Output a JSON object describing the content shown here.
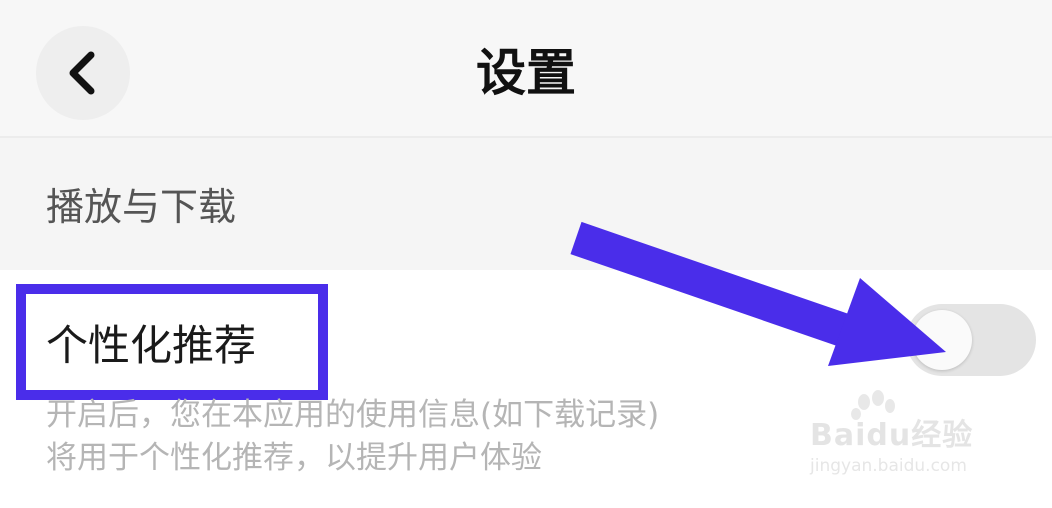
{
  "header": {
    "title": "设置",
    "back_icon": "chevron-left-icon"
  },
  "section": {
    "title": "播放与下载"
  },
  "setting": {
    "label": "个性化推荐",
    "description_line1": "开启后，您在本应用的使用信息(如下载记录)",
    "description_line2": "将用于个性化推荐，以提升用户体验",
    "toggle_on": false
  },
  "annotation": {
    "color": "#4a2dea"
  },
  "watermark": {
    "brand": "Baidu经验",
    "url": "jingyan.baidu.com"
  }
}
